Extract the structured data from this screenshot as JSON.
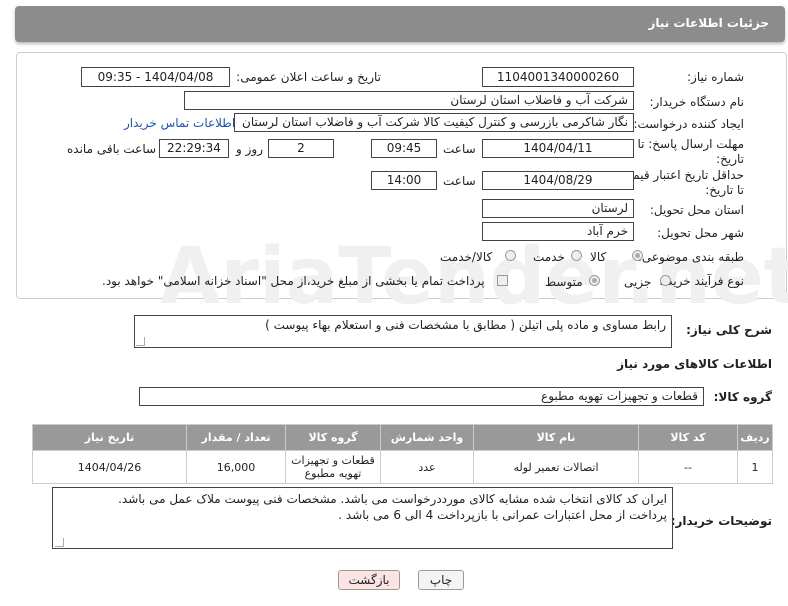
{
  "header": {
    "title": "جزئیات اطلاعات نیاز"
  },
  "watermark": {
    "text": "AriaTender.net"
  },
  "form": {
    "need_number_label": "شماره نیاز:",
    "need_number": "1104001340000260",
    "announce_label": "تاریخ و ساعت اعلان عمومی:",
    "announce_value": "1404/04/08 - 09:35",
    "buyer_label": "نام دستگاه خریدار:",
    "buyer_value": "شرکت آب و فاضلاب استان لرستان",
    "creator_label": "ایجاد کننده درخواست:",
    "creator_value": "نگار شاکرمی بازرسی و کنترل کیفیت کالا شرکت آب و فاضلاب استان لرستان",
    "contact_link": "اطلاعات تماس خریدار",
    "reply_deadline_label_1": "مهلت ارسال پاسخ: تا",
    "reply_deadline_label_2": "تاریخ:",
    "reply_date": "1404/04/11",
    "time_label": "ساعت",
    "reply_time": "09:45",
    "days_value": "2",
    "days_label": "روز و",
    "remaining_value": "22:29:34",
    "remaining_label": "ساعت باقی مانده",
    "validity_label_1": "حداقل تاریخ اعتبار قیمت:",
    "validity_label_2": "تا تاریخ:",
    "validity_date": "1404/08/29",
    "validity_time_label": "ساعت",
    "validity_time": "14:00",
    "province_label": "استان محل تحویل:",
    "province_value": "لرستان",
    "city_label": "شهر محل تحویل:",
    "city_value": "خرم آباد",
    "category_label": "طبقه بندی موضوعی:",
    "category_options": [
      "کالا",
      "خدمت",
      "کالا/خدمت"
    ],
    "category_selected": "کالا",
    "process_label": "نوع فرآیند خرید :",
    "process_options": [
      "جزیی",
      "متوسط"
    ],
    "process_selected": "متوسط",
    "payment_note": "پرداخت تمام یا بخشی از مبلغ خرید،از محل \"اسناد خزانه اسلامی\" خواهد بود."
  },
  "description": {
    "label": "شرح کلی نیاز:",
    "value": "رابط مساوی و ماده پلی اتیلن ( مطابق با مشخصات فنی و استعلام بهاء پیوست )"
  },
  "goods_info": {
    "title": "اطلاعات کالاهای مورد نیاز",
    "group_label": "گروه کالا:",
    "group_value": "قطعات و تجهیزات تهویه مطبوع"
  },
  "table": {
    "headers": [
      "ردیف",
      "کد کالا",
      "نام کالا",
      "واحد شمارش",
      "گروه کالا",
      "تعداد / مقدار",
      "تاریخ نیاز"
    ],
    "rows": [
      {
        "row": "1",
        "code": "--",
        "name": "اتصالات تعمیر لوله",
        "unit": "عدد",
        "group_line1": "قطعات و تجهیزات",
        "group_line2": "تهویه مطبوع",
        "qty": "16,000",
        "date": "1404/04/26"
      }
    ]
  },
  "buyer_notes": {
    "label": "توضیحات خریدار:",
    "line1": "ایران کد کالای انتخاب شده مشابه کالای مورددرخواست می باشد. مشخصات فنی پیوست ملاک عمل می باشد.",
    "line2": "پرداخت از محل اعتبارات عمرانی با بازپرداخت 4 الی 6  می باشد ."
  },
  "buttons": {
    "print": "چاپ",
    "back": "بازگشت"
  },
  "colors": {
    "header_bg": "#8c8c8c",
    "table_header_bg": "#999999",
    "link": "#1a55b5",
    "back_btn_bg": "#fde4e4",
    "print_btn_bg": "#f4f4f4"
  }
}
